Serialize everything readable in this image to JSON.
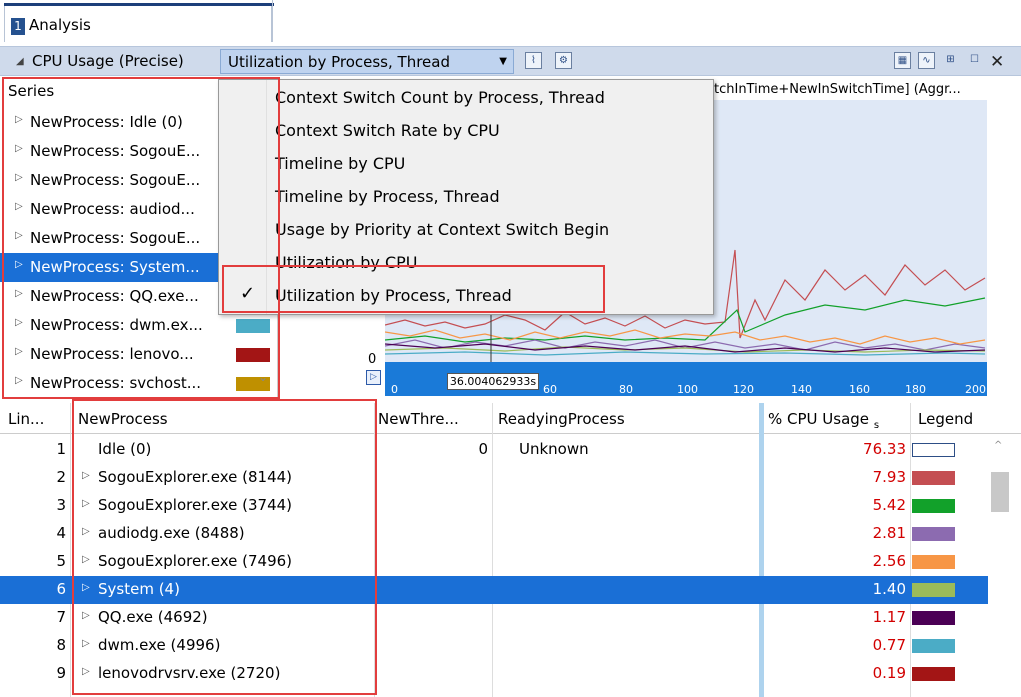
{
  "tab": {
    "number": "1",
    "label": "Analysis"
  },
  "toolbar": {
    "graph_title": "CPU Usage (Precise)",
    "preset": "Utilization by Process, Thread",
    "close_glyph": "✕",
    "icons": [
      "chart-icon",
      "settings-icon",
      "graph-view-icon",
      "line-view-icon",
      "table-view-icon",
      "maximize-icon",
      "close-icon"
    ]
  },
  "series": {
    "header": "Series",
    "items": [
      {
        "label": "NewProcess: Idle (0)",
        "color": ""
      },
      {
        "label": "NewProcess: SogouE...",
        "color": "#c44e52"
      },
      {
        "label": "NewProcess: SogouE...",
        "color": "#12a12a"
      },
      {
        "label": "NewProcess: audiod...",
        "color": "#8c6bb0"
      },
      {
        "label": "NewProcess: SogouE...",
        "color": "#f79646"
      },
      {
        "label": "NewProcess: System...",
        "color": "#9bbb59",
        "selected": true
      },
      {
        "label": "NewProcess: QQ.exe...",
        "color": "#4b0055"
      },
      {
        "label": "NewProcess: dwm.ex...",
        "color": "#4bacc6"
      },
      {
        "label": "NewProcess: lenovo...",
        "color": "#a31515"
      },
      {
        "label": "NewProcess: svchost...",
        "color": "#bf9000"
      }
    ]
  },
  "chart": {
    "caption": "tchInTime+NewInSwitchTime] (Aggr...",
    "y_zero": "0",
    "cursor_label": "36.004062933s",
    "x_ticks": [
      "0",
      "60",
      "80",
      "100",
      "120",
      "140",
      "160",
      "180",
      "200"
    ]
  },
  "menu": {
    "items": [
      "Context Switch Count by Process, Thread",
      "Context Switch Rate by CPU",
      "Timeline by CPU",
      "Timeline by Process, Thread",
      "Usage by Priority at Context Switch Begin",
      "Utilization by CPU",
      "Utilization by Process, Thread"
    ],
    "checked_index": 6,
    "check_glyph": "✓"
  },
  "grid": {
    "columns": {
      "line": "Lin...",
      "process": "NewProcess",
      "thread": "NewThre...",
      "readying": "ReadyingProcess",
      "usage": "% CPU Usage",
      "usage_sub": "s",
      "legend": "Legend"
    },
    "rows": [
      {
        "line": "1",
        "name": "Idle (0)",
        "thread": "0",
        "readying": "Unknown",
        "pct": "76.33",
        "color": "#ffffff",
        "expandable": false
      },
      {
        "line": "2",
        "name": "SogouExplorer.exe (8144)",
        "thread": "",
        "readying": "",
        "pct": "7.93",
        "color": "#c44e52",
        "expandable": true
      },
      {
        "line": "3",
        "name": "SogouExplorer.exe (3744)",
        "thread": "",
        "readying": "",
        "pct": "5.42",
        "color": "#12a12a",
        "expandable": true
      },
      {
        "line": "4",
        "name": "audiodg.exe (8488)",
        "thread": "",
        "readying": "",
        "pct": "2.81",
        "color": "#8c6bb0",
        "expandable": true
      },
      {
        "line": "5",
        "name": "SogouExplorer.exe (7496)",
        "thread": "",
        "readying": "",
        "pct": "2.56",
        "color": "#f79646",
        "expandable": true
      },
      {
        "line": "6",
        "name": "System (4)",
        "thread": "",
        "readying": "",
        "pct": "1.40",
        "color": "#9bbb59",
        "expandable": true,
        "selected": true
      },
      {
        "line": "7",
        "name": "QQ.exe (4692)",
        "thread": "",
        "readying": "",
        "pct": "1.17",
        "color": "#4b0055",
        "expandable": true
      },
      {
        "line": "8",
        "name": "dwm.exe (4996)",
        "thread": "",
        "readying": "",
        "pct": "0.77",
        "color": "#4bacc6",
        "expandable": true
      },
      {
        "line": "9",
        "name": "lenovodrvsrv.exe (2720)",
        "thread": "",
        "readying": "",
        "pct": "0.19",
        "color": "#a31515",
        "expandable": true
      }
    ]
  }
}
